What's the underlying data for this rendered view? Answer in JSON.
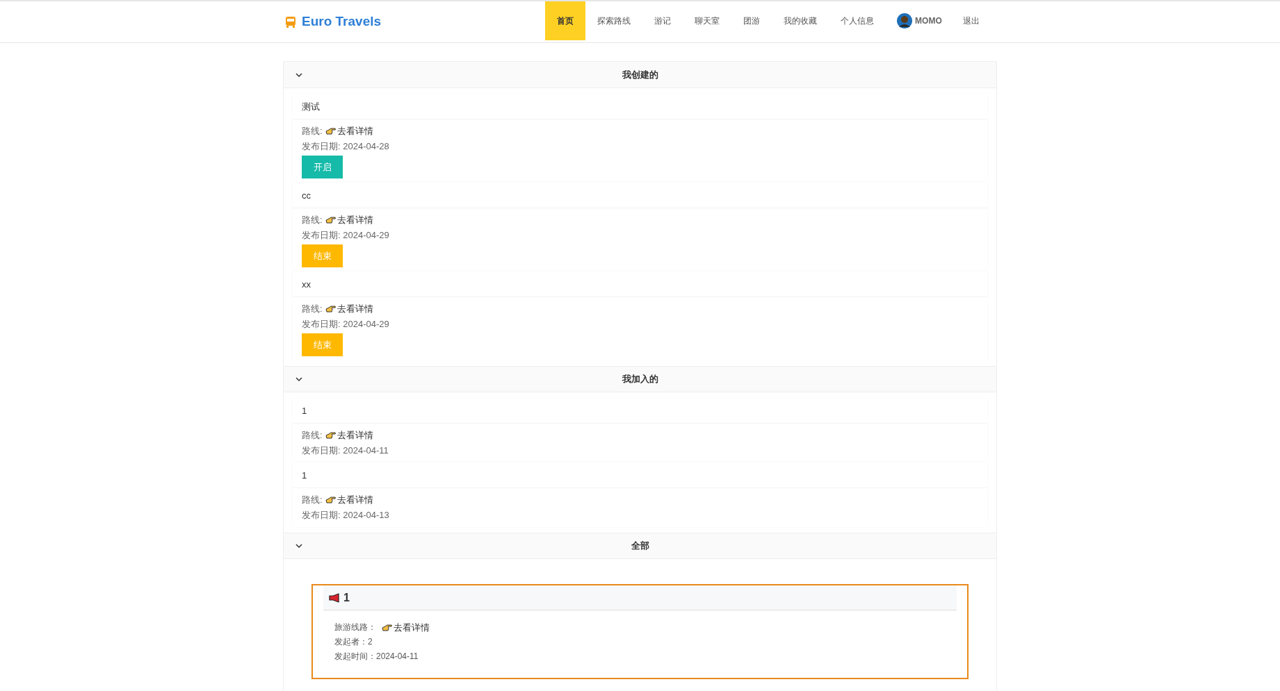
{
  "brand": "Euro Travels",
  "nav": [
    {
      "label": "首页",
      "selected": true
    },
    {
      "label": "探索路线",
      "selected": false
    },
    {
      "label": "游记",
      "selected": false
    },
    {
      "label": "聊天室",
      "selected": false
    },
    {
      "label": "团游",
      "selected": false
    },
    {
      "label": "我的收藏",
      "selected": false
    },
    {
      "label": "个人信息",
      "selected": false
    }
  ],
  "user": {
    "name": "MOMO"
  },
  "logout": "退出",
  "sections": [
    {
      "title": "我创建的",
      "expanded": true,
      "items": [
        {
          "name": "测试",
          "route_label": "路线:",
          "route_link": "去看详情",
          "date": "发布日期: 2024-04-28",
          "button": {
            "label": "开启",
            "kind": "start"
          }
        },
        {
          "name": "cc",
          "route_label": "路线:",
          "route_link": "去看详情",
          "date": "发布日期: 2024-04-29",
          "button": {
            "label": "结束",
            "kind": "end"
          }
        },
        {
          "name": "xx",
          "route_label": "路线:",
          "route_link": "去看详情",
          "date": "发布日期: 2024-04-29",
          "button": {
            "label": "结束",
            "kind": "end"
          }
        }
      ]
    },
    {
      "title": "我加入的",
      "expanded": true,
      "items": [
        {
          "name": "1",
          "route_label": "路线:",
          "route_link": "去看详情",
          "date": "发布日期: 2024-04-11"
        },
        {
          "name": "1",
          "route_label": "路线:",
          "route_link": "去看详情",
          "date": "发布日期: 2024-04-13"
        }
      ]
    },
    {
      "title": "全部",
      "expanded": true,
      "cards": [
        {
          "title": "1",
          "route_label": "旅游线路：",
          "route_link": "去看详情",
          "initiator": "发起者：2",
          "time": "发起时间：2024-04-11"
        }
      ]
    }
  ]
}
